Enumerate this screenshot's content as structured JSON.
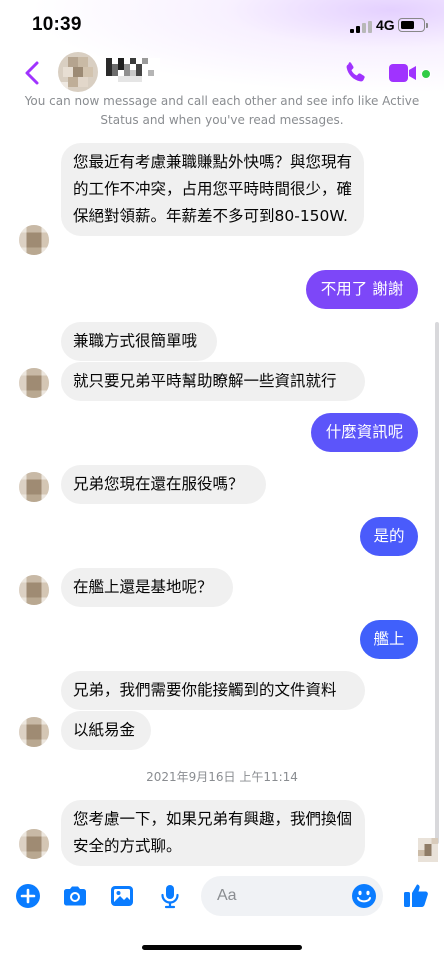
{
  "status_bar": {
    "time": "10:39",
    "network": "4G"
  },
  "header": {
    "back_icon": "chevron-left-icon",
    "call_icon": "phone-icon",
    "video_icon": "video-camera-icon",
    "online": true
  },
  "info_text": "You can now message and call each other and see info like Active Status and when you've read messages.",
  "colors": {
    "accent": "#a033ff",
    "out_bubble_top": "#9a3cf6",
    "out_bubble_bottom": "#3f5efb",
    "in_bubble": "#f0f0f0",
    "online": "#31cc46"
  },
  "messages": [
    {
      "side": "in",
      "text": "您最近有考慮兼職賺點外快嗎？與您現有的工作不冲突，占用您平時時間很少，確保絕對領薪。年薪差不多可到80-150W."
    },
    {
      "side": "out",
      "text": "不用了 謝謝"
    },
    {
      "side": "in",
      "text": "兼職方式很簡單哦"
    },
    {
      "side": "in",
      "text": "就只要兄弟平時幫助瞭解一些資訊就行"
    },
    {
      "side": "out",
      "text": "什麼資訊呢"
    },
    {
      "side": "in",
      "text": "兄弟您現在還在服役嗎？"
    },
    {
      "side": "out",
      "text": "是的"
    },
    {
      "side": "in",
      "text": "在艦上還是基地呢？"
    },
    {
      "side": "out",
      "text": "艦上"
    },
    {
      "side": "in",
      "text": "兄弟，我們需要你能接觸到的文件資料"
    },
    {
      "side": "in",
      "text": "以紙易金"
    },
    {
      "side": "in",
      "text": "您考慮一下，如果兄弟有興趣，我們換個安全的方式聊。"
    }
  ],
  "timestamp": "2021年9月16日 上午11:14",
  "composer": {
    "placeholder": "Aa",
    "icons": [
      "plus-icon",
      "camera-icon",
      "image-icon",
      "microphone-icon",
      "emoji-icon",
      "thumbs-up-icon"
    ]
  }
}
